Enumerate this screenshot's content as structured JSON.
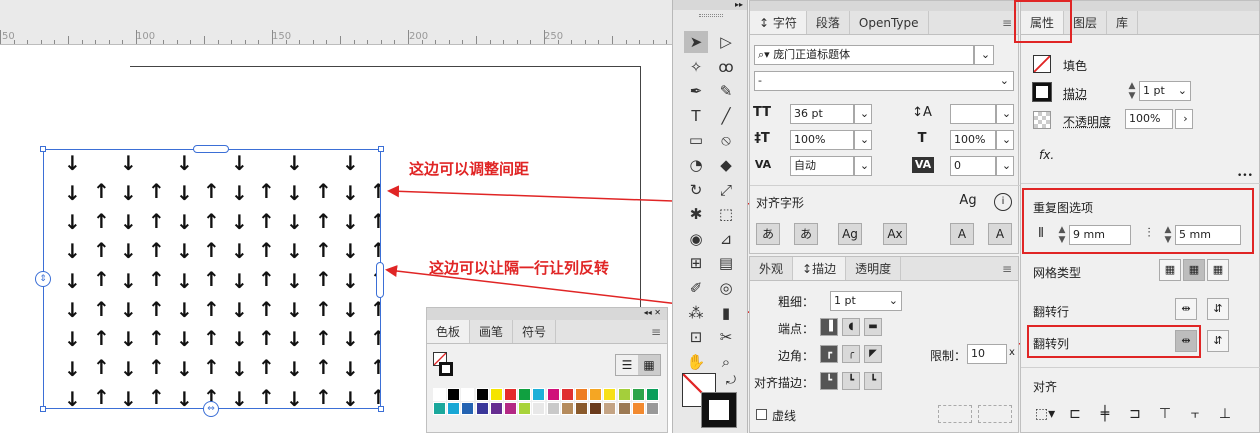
{
  "ruler": {
    "labels": [
      "50",
      "100",
      "150",
      "200",
      "250"
    ]
  },
  "annotations": {
    "spacing": "这边可以调整间距",
    "flip": "这边可以让隔一行让列反转"
  },
  "character_panel": {
    "tabs": [
      "字符",
      "段落",
      "OpenType"
    ],
    "font_family": "庞门正道标题体",
    "font_style": "-",
    "font_size": "36 pt",
    "leading": "",
    "vscale": "100%",
    "hscale": "100%",
    "kerning": "自动",
    "tracking": "0",
    "align_glyph_label": "对齐字形",
    "glyph_buttons": [
      "あ",
      "あ",
      "Ag",
      "Ax",
      "A",
      "A"
    ]
  },
  "stroke_panel": {
    "tabs": [
      "外观",
      "描边",
      "透明度"
    ],
    "weight_label": "粗细：",
    "weight": "1 pt",
    "cap_label": "端点：",
    "corner_label": "边角：",
    "limit_label": "限制：",
    "limit": "10",
    "limit_unit": "x",
    "align_label": "对齐描边：",
    "dashed_label": "虚线"
  },
  "swatches_panel": {
    "tabs": [
      "色板",
      "画笔",
      "符号"
    ],
    "colors": [
      "#ffffff",
      "#000000",
      "#ffffff",
      "#000000",
      "#f5e400",
      "#e52b2b",
      "#10a040",
      "#1cb0d8",
      "#d0107a",
      "#e03030",
      "#ee7d22",
      "#f5a623",
      "#f7e017",
      "#a4cf3b",
      "#2ca44a",
      "#0a9e5a",
      "#1ba89c",
      "#19a7d5",
      "#2463b2",
      "#3a3799",
      "#662d91",
      "#b42884",
      "#a8d33a",
      "#e8e8e8",
      "#c9c9c9",
      "#b58b5c",
      "#8a5a2c",
      "#6b3b1c",
      "#c4a484",
      "#9c7a54",
      "#f28a30",
      "#999999"
    ]
  },
  "properties_panel": {
    "tabs": [
      "属性",
      "图层",
      "库"
    ],
    "fill_label": "填色",
    "stroke_label": "描边",
    "stroke_value": "1 pt",
    "opacity_label": "不透明度",
    "opacity_value": "100%",
    "fx_label": "fx.",
    "more": "•••",
    "repeat_title": "重复图选项",
    "h_spacing": "9 mm",
    "v_spacing": "5 mm",
    "grid_type_label": "网格类型",
    "flip_row_label": "翻转行",
    "flip_col_label": "翻转列",
    "align_label": "对齐"
  },
  "colors": {
    "annotation": "#e02525",
    "selection": "#3b6fd6",
    "panel_bg": "#f0f0f0"
  },
  "pattern": {
    "rows_down": "↓",
    "rows_up": "↑"
  }
}
